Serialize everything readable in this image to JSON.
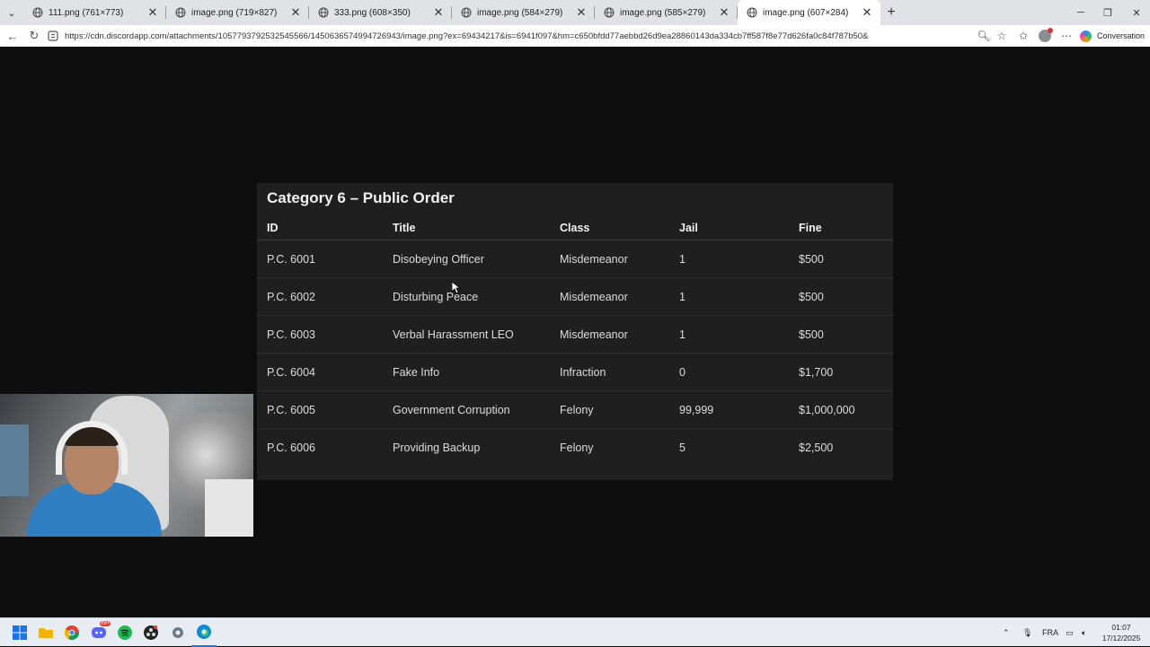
{
  "browser": {
    "tabs": [
      {
        "label": "111.png (761×773)",
        "active": false
      },
      {
        "label": "image.png (719×827)",
        "active": false
      },
      {
        "label": "333.png (608×350)",
        "active": false
      },
      {
        "label": "image.png (584×279)",
        "active": false
      },
      {
        "label": "image.png (585×279)",
        "active": false
      },
      {
        "label": "image.png (607×284)",
        "active": true
      }
    ],
    "close_glyph": "✕",
    "new_tab_glyph": "+",
    "url": "https://cdn.discordapp.com/attachments/1057793792532545566/1450636574994726943/image.png?ex=69434217&is=6941f097&hm=c650bfdd77aebbd26d9ea28860143da334cb7ff587f8e77d626fa0c84f787b50&",
    "conversation_label": "Conversation"
  },
  "document": {
    "title": "Category 6 – Public Order",
    "headers": {
      "id": "ID",
      "title": "Title",
      "class": "Class",
      "jail": "Jail",
      "fine": "Fine"
    },
    "rows": [
      {
        "id": "P.C. 6001",
        "title": "Disobeying Officer",
        "class": "Misdemeanor",
        "jail": "1",
        "fine": "$500"
      },
      {
        "id": "P.C. 6002",
        "title": "Disturbing Peace",
        "class": "Misdemeanor",
        "jail": "1",
        "fine": "$500"
      },
      {
        "id": "P.C. 6003",
        "title": "Verbal Harassment LEO",
        "class": "Misdemeanor",
        "jail": "1",
        "fine": "$500"
      },
      {
        "id": "P.C. 6004",
        "title": "Fake Info",
        "class": "Infraction",
        "jail": "0",
        "fine": "$1,700"
      },
      {
        "id": "P.C. 6005",
        "title": "Government Corruption",
        "class": "Felony",
        "jail": "99,999",
        "fine": "$1,000,000"
      },
      {
        "id": "P.C. 6006",
        "title": "Providing Backup",
        "class": "Felony",
        "jail": "5",
        "fine": "$2,500"
      }
    ]
  },
  "taskbar": {
    "language": "FRA",
    "time": "01:07",
    "date": "17/12/2025",
    "discord_badge": "99+"
  },
  "colors": {
    "accent": "#0b57d0",
    "page_bg": "#0e0e0e",
    "doc_bg": "#1f1f1f"
  }
}
